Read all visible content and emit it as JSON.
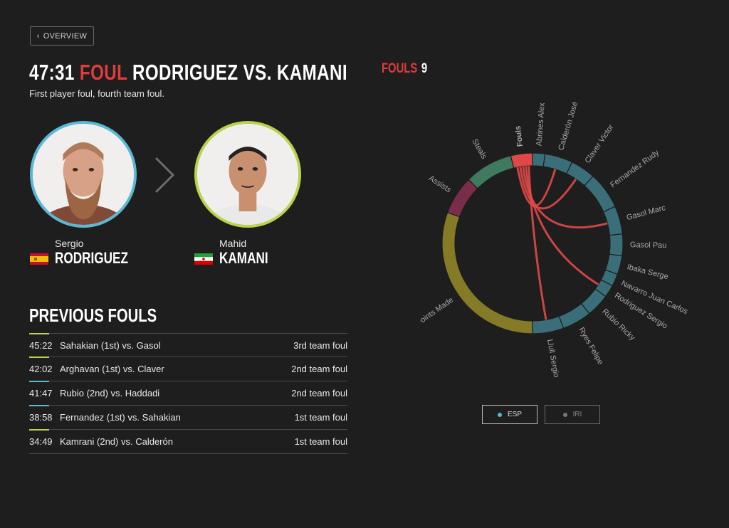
{
  "nav": {
    "overview_label": "OVERVIEW"
  },
  "event": {
    "time": "47:31",
    "type": "FOUL",
    "matchup": "RODRIGUEZ VS. KAMANI",
    "description": "First player foul, fourth team foul."
  },
  "fouler": {
    "first": "Sergio",
    "last": "RODRIGUEZ",
    "team": "ESP"
  },
  "fouled": {
    "first": "Mahid",
    "last": "KAMANI",
    "team": "IRI"
  },
  "previous": {
    "title": "PREVIOUS FOULS",
    "rows": [
      {
        "time": "45:22",
        "desc": "Sahakian (1st) vs. Gasol",
        "team": "3rd team foul",
        "accent": "#b9d34a"
      },
      {
        "time": "42:02",
        "desc": "Arghavan (1st) vs. Claver",
        "team": "2nd team foul",
        "accent": "#b9d34a"
      },
      {
        "time": "41:47",
        "desc": "Rubio (2nd) vs. Haddadi",
        "team": "2nd team foul",
        "accent": "#5ab8d4"
      },
      {
        "time": "38:58",
        "desc": "Fernandez (1st) vs. Sahakian",
        "team": "1st team foul",
        "accent": "#5ab8d4"
      },
      {
        "time": "34:49",
        "desc": "Kamrani (2nd) vs. Calderón",
        "team": "1st team foul",
        "accent": "#b9d34a"
      }
    ]
  },
  "fouls_summary": {
    "label": "FOULS",
    "count": "9"
  },
  "chart_data": {
    "type": "chord",
    "categories": [
      {
        "label": "Fouls",
        "color": "#e04848",
        "highlight": true
      },
      {
        "label": "Abrines Alex",
        "color": "#3a6f7a"
      },
      {
        "label": "Calderón José",
        "color": "#3a6f7a"
      },
      {
        "label": "Claver Victor",
        "color": "#3a6f7a"
      },
      {
        "label": "Fernandez Rudy",
        "color": "#3a6f7a"
      },
      {
        "label": "Gasol Marc",
        "color": "#3a6f7a"
      },
      {
        "label": "Gasol Pau",
        "color": "#3a6f7a"
      },
      {
        "label": "Ibaka Serge",
        "color": "#3a6f7a"
      },
      {
        "label": "Navarro Juan Carlos",
        "color": "#3a6f7a"
      },
      {
        "label": "Rodriguez Sergio",
        "color": "#3a6f7a"
      },
      {
        "label": "Rubio Ricky",
        "color": "#3a6f7a"
      },
      {
        "label": "Ryes Felipe",
        "color": "#3a6f7a"
      },
      {
        "label": "Llull Sergio",
        "color": "#3a6f7a"
      },
      {
        "label": "Points Made",
        "color": "#857a26"
      },
      {
        "label": "Assists",
        "color": "#7a2d4a"
      },
      {
        "label": "Steals",
        "color": "#3f7a5e"
      }
    ],
    "links": [
      {
        "from": "Fouls",
        "to": "Calderón José"
      },
      {
        "from": "Fouls",
        "to": "Claver Victor"
      },
      {
        "from": "Fouls",
        "to": "Gasol Marc"
      },
      {
        "from": "Fouls",
        "to": "Rodriguez Sergio"
      },
      {
        "from": "Fouls",
        "to": "Llull Sergio"
      }
    ],
    "link_color": "#e04848"
  },
  "legend": [
    {
      "label": "ESP",
      "color": "#5ab8d4",
      "active": true
    },
    {
      "label": "IRI",
      "color": "#777777",
      "active": false
    }
  ],
  "icons": {
    "back": "chevron-left-icon",
    "next": "chevron-right-icon"
  }
}
